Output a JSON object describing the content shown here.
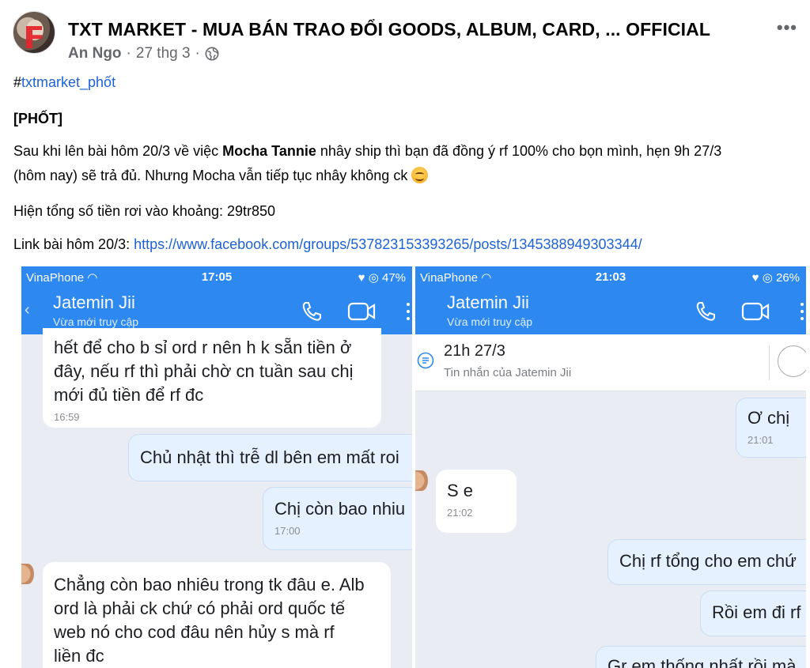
{
  "post": {
    "group_name": "TXT MARKET - MUA BÁN TRAO ĐỔI GOODS, ALBUM, CARD, ... OFFICIAL",
    "author": "An Ngo",
    "date": "27 thg 3",
    "separator": "·",
    "more_label": "•••",
    "hash_symbol": "#",
    "hashtag": "txtmarket_phốt",
    "tag_line": "[PHỐT]",
    "para1_a": "Sau khi lên bài hôm 20/3 về việc ",
    "para1_bold": "Mocha Tannie",
    "para1_b": " nhây ship thì bạn đã đồng ý rf 100% cho bọn mình, hẹn 9h 27/3",
    "para1_c": "(hôm nay) sẽ trả đủ. Nhưng Mocha vẫn tiếp tục nhây không ck ",
    "para2": "Hiện tổng số tiền rơi vào khoảng: 29tr850",
    "link_prefix": "Link bài hôm 20/3: ",
    "link_url": "https://www.facebook.com/groups/537823153393265/posts/1345388949303344/"
  },
  "left_shot": {
    "carrier": "VinaPhone ",
    "clock": "17:05",
    "battery": "♥ ◎ 47%",
    "contact": "Jatemin Jii",
    "presence": "Vừa mới truy cập",
    "m1_l1": "hết để cho b sỉ ord r nên h k sẵn tiền ở",
    "m1_l2": "đây, nếu rf thì phải chờ cn tuần sau chị",
    "m1_l3": "mới đủ tiền để rf đc",
    "m1_time": "16:59",
    "m2": "Chủ nhật thì trễ dl bên em mất roi",
    "m3": "Chị còn bao nhiu",
    "m3_time": "17:00",
    "m4_l1": "Chẳng còn bao nhiêu trong tk đâu e. Alb",
    "m4_l2": "ord là phải ck chứ có phải ord quốc tế",
    "m4_l3": "web nó cho cod đâu nên hủy s mà rf",
    "m4_l4": "liền đc"
  },
  "right_shot": {
    "carrier": "VinaPhone ",
    "clock": "21:03",
    "battery": "♥ ◎ 26%",
    "contact": "Jatemin Jii",
    "presence": "Vừa mới truy cập",
    "pin_title": "21h 27/3",
    "pin_sub": "Tin nhắn của Jatemin Jii",
    "m1": "Ơ chị",
    "m1_time": "21:01",
    "m2": "S e",
    "m2_time": "21:02",
    "m3": "Chị rf tổng cho em chứ",
    "m4": "Rồi em đi rf",
    "m5": "Gr em thống nhất rồi mà"
  },
  "colors": {
    "link": "#1d62d6",
    "zalo_blue": "#2d88f0",
    "out_bubble": "#e5f1ff"
  }
}
